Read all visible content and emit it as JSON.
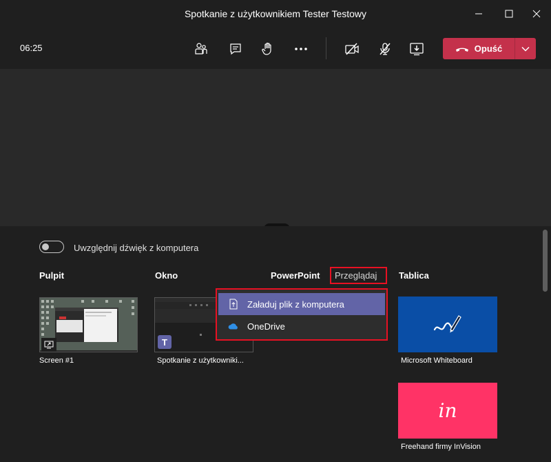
{
  "window": {
    "title": "Spotkanie z użytkownikiem Tester Testowy"
  },
  "toolbar": {
    "timer": "06:25",
    "leave_label": "Opuść",
    "icons": [
      "people-icon",
      "chat-icon",
      "raise-hand-icon",
      "more-options-icon",
      "camera-off-icon",
      "mic-off-icon",
      "share-tray-icon"
    ]
  },
  "share": {
    "audio_toggle_label": "Uwzględnij dźwięk z komputera",
    "audio_toggle_on": false,
    "sections": {
      "desktop": "Pulpit",
      "window": "Okno",
      "powerpoint": "PowerPoint",
      "browse": "Przeglądaj",
      "whiteboard": "Tablica"
    },
    "screens": [
      {
        "caption": "Screen #1"
      }
    ],
    "windows": [
      {
        "caption": "Spotkanie z użytkowniki..."
      }
    ],
    "browse_menu": [
      {
        "label": "Załaduj plik z komputera",
        "icon": "upload-file-icon",
        "highlighted": true
      },
      {
        "label": "OneDrive",
        "icon": "onedrive-icon",
        "highlighted": false
      }
    ],
    "boards": [
      {
        "caption": "Microsoft Whiteboard",
        "color": "#0a4ea6"
      },
      {
        "caption": "Freehand firmy InVision",
        "color": "#ff3366",
        "logo_text": "in"
      }
    ]
  },
  "colors": {
    "leave": "#c4314b",
    "menu_highlight": "#6264a7",
    "annotation_red": "#e81123"
  }
}
